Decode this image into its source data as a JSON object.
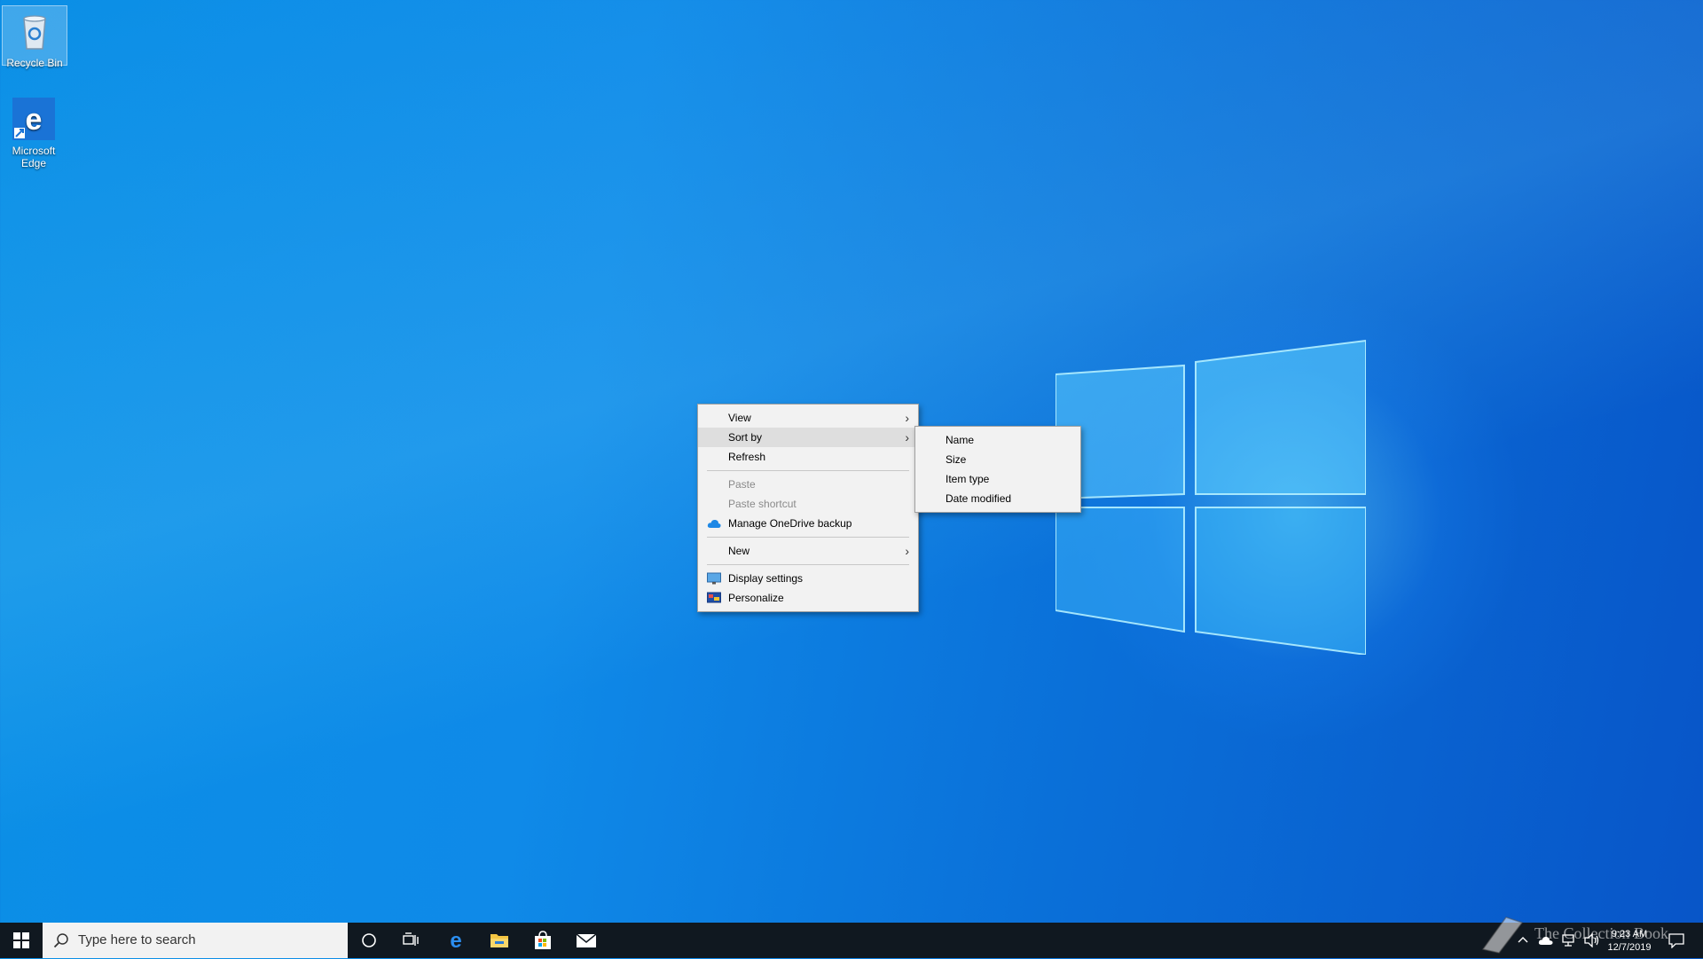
{
  "desktop": {
    "icons": [
      {
        "label": "Recycle Bin",
        "icon": "recycle-bin-icon"
      },
      {
        "label": "Microsoft Edge",
        "icon": "edge-icon"
      }
    ]
  },
  "context_menu": {
    "items": [
      {
        "label": "View",
        "submenu": true
      },
      {
        "label": "Sort by",
        "submenu": true,
        "highlighted": true
      },
      {
        "label": "Refresh"
      },
      {
        "label": "Paste",
        "disabled": true
      },
      {
        "label": "Paste shortcut",
        "disabled": true
      },
      {
        "label": "Manage OneDrive backup",
        "icon": "onedrive-cloud-icon"
      },
      {
        "label": "New",
        "submenu": true
      },
      {
        "label": "Display settings",
        "icon": "display-icon"
      },
      {
        "label": "Personalize",
        "icon": "personalize-icon"
      }
    ],
    "arrow_glyph": "›"
  },
  "sort_submenu": {
    "items": [
      {
        "label": "Name"
      },
      {
        "label": "Size"
      },
      {
        "label": "Item type"
      },
      {
        "label": "Date modified"
      }
    ]
  },
  "taskbar": {
    "search_placeholder": "Type here to search",
    "pinned": [
      "cortana-icon",
      "task-view-icon",
      "edge-icon",
      "file-explorer-icon",
      "store-icon",
      "mail-icon"
    ],
    "clock": {
      "time": "9:23 AM",
      "date": "12/7/2019"
    }
  },
  "watermark": "The Collection Book",
  "colors": {
    "accent": "#0a78d7",
    "menu_bg": "#f2f2f2",
    "taskbar": "#101820"
  }
}
